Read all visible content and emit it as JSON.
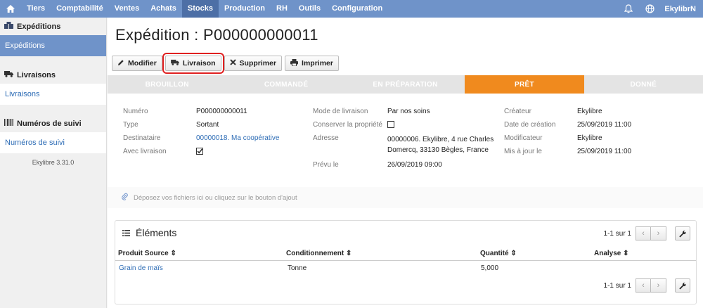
{
  "topnav": {
    "items": [
      "Tiers",
      "Comptabilité",
      "Ventes",
      "Achats",
      "Stocks",
      "Production",
      "RH",
      "Outils",
      "Configuration"
    ],
    "active": "Stocks",
    "user": "EkylibrN"
  },
  "sidebar": {
    "sections": [
      {
        "heading": "Expéditions",
        "item": "Expéditions"
      },
      {
        "heading": "Livraisons",
        "item": "Livraisons"
      },
      {
        "heading": "Numéros de suivi",
        "item": "Numéros de suivi"
      }
    ],
    "version": "Ekylibre 3.31.0"
  },
  "page": {
    "title": "Expédition : P000000000011"
  },
  "toolbar": {
    "modifier": "Modifier",
    "livraison": "Livraison",
    "supprimer": "Supprimer",
    "imprimer": "Imprimer"
  },
  "steps": [
    "BROUILLON",
    "COMMANDÉ",
    "EN PRÉPARATION",
    "PRÊT",
    "DONNÉ"
  ],
  "active_step": "PRÊT",
  "fields": {
    "col1": {
      "numero_label": "Numéro",
      "numero": "P000000000011",
      "type_label": "Type",
      "type": "Sortant",
      "destinataire_label": "Destinataire",
      "destinataire": "00000018. Ma coopérative",
      "avec_livraison_label": "Avec livraison"
    },
    "col2": {
      "mode_label": "Mode de livraison",
      "mode": "Par nos soins",
      "conserver_label": "Conserver la propriété",
      "adresse_label": "Adresse",
      "adresse_line1": "00000006. Ekylibre, 4 rue Charles",
      "adresse_line2": "Domercq, 33130 Bègles, France",
      "prevu_label": "Prévu le",
      "prevu": "26/09/2019 09:00"
    },
    "col3": {
      "createur_label": "Créateur",
      "createur": "Ekylibre",
      "date_creation_label": "Date de création",
      "date_creation": "25/09/2019 11:00",
      "modificateur_label": "Modificateur",
      "modificateur": "Ekylibre",
      "maj_label": "Mis à jour le",
      "maj": "25/09/2019 11:00"
    }
  },
  "dropzone": {
    "text": "Déposez vos fichiers ici ou cliquez sur le bouton d'ajout"
  },
  "elements": {
    "title": "Éléments",
    "pagination": "1-1 sur 1",
    "columns": [
      "Produit Source",
      "Conditionnement",
      "Quantité",
      "Analyse"
    ],
    "rows": [
      {
        "produit": "Grain de maïs",
        "conditionnement": "Tonne",
        "quantite": "5,000",
        "analyse": ""
      }
    ]
  }
}
